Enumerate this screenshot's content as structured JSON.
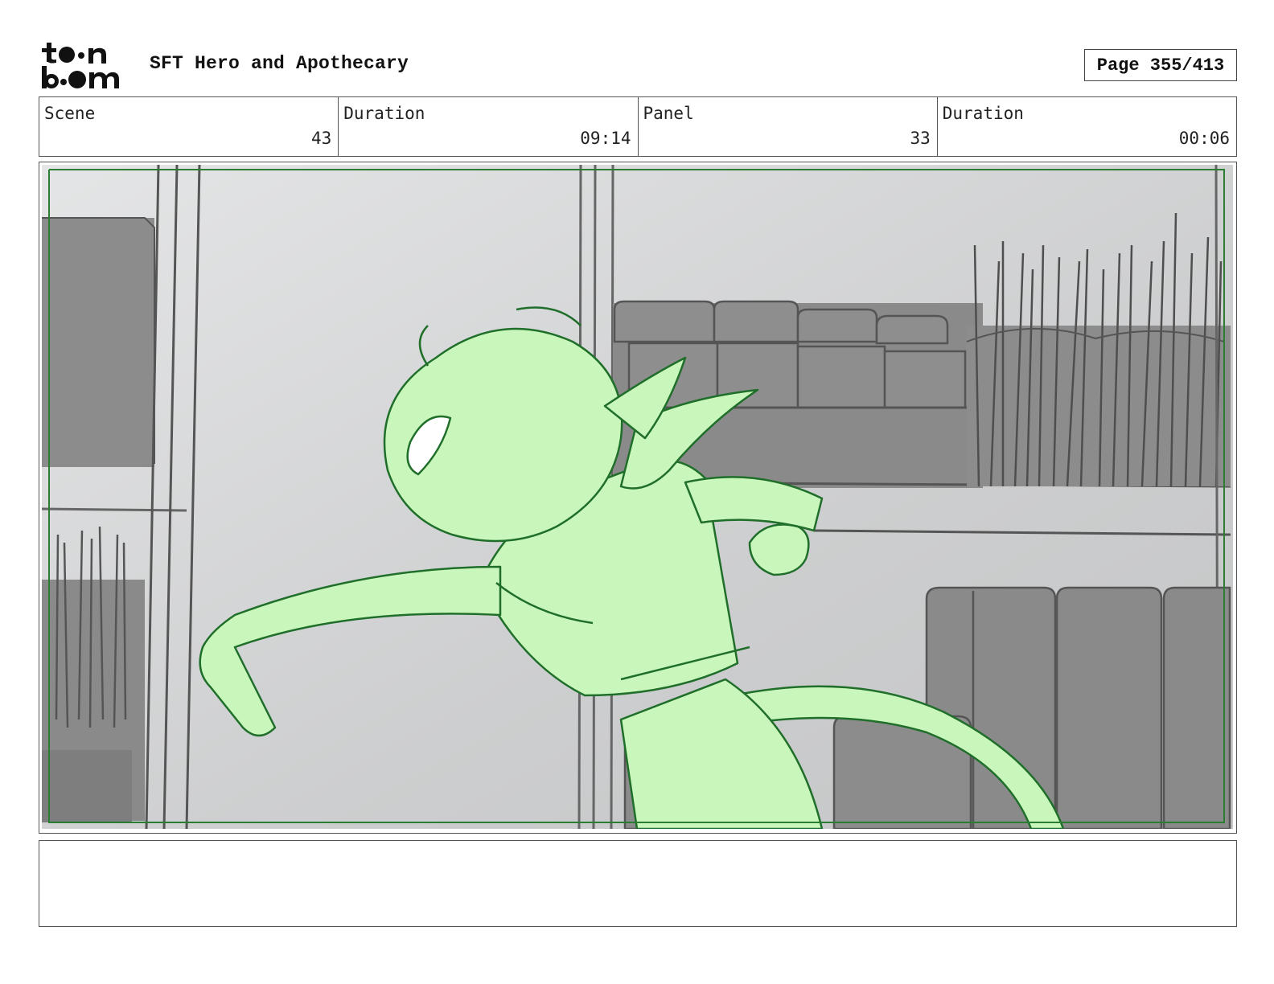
{
  "header": {
    "logo_text": "toon boom",
    "project_title": "SFT Hero and Apothecary",
    "page_label": "Page 355/413"
  },
  "info": {
    "scene": {
      "label": "Scene",
      "value": "43"
    },
    "scene_duration": {
      "label": "Duration",
      "value": "09:14"
    },
    "panel": {
      "label": "Panel",
      "value": "33"
    },
    "panel_duration": {
      "label": "Duration",
      "value": "00:06"
    }
  },
  "panel_image": {
    "subject": "green character sketch punching in a store aisle with shelves",
    "colors": {
      "background": "#cfd0d1",
      "shelf_fill": "#8a8a8a",
      "line_gray": "#555555",
      "character_fill": "#c8f5b8",
      "character_line": "#1f6e2a",
      "safe_frame": "#2a7d32"
    }
  },
  "notes": {
    "text": ""
  }
}
